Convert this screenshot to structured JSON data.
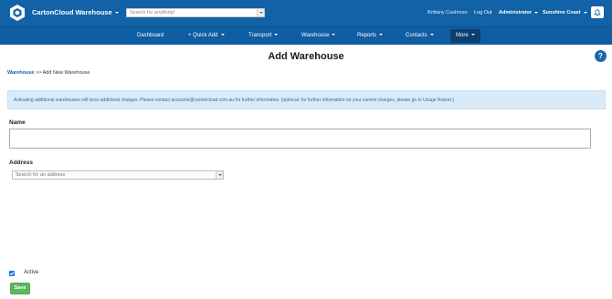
{
  "header": {
    "brand": "CartonCloud Warehouse",
    "search_placeholder": "Search for anything!",
    "user_name": "Brittany Cashman",
    "logout_label": "Log Out",
    "role": "Administrator",
    "region": "Sunshine Coast"
  },
  "nav": {
    "items": [
      {
        "label": "Dashboard"
      },
      {
        "label": "+ Quick Add"
      },
      {
        "label": "Transport"
      },
      {
        "label": "Warehouse"
      },
      {
        "label": "Reports"
      },
      {
        "label": "Contacts"
      },
      {
        "label": "More"
      }
    ],
    "active_index": 6
  },
  "page": {
    "title": "Add Warehouse",
    "help_label": "?",
    "breadcrumb_link": "Warehouse",
    "breadcrumb_sep": " >> ",
    "breadcrumb_current": "Add New Warehouse",
    "notice": "Activating additional warehouses will incur additional charges. Please contact accounts@cartoncloud.com.au for further information. [optional: for further information on your current charges, please go to Usage Report.]"
  },
  "form": {
    "name_label": "Name",
    "name_value": "",
    "address_label": "Address",
    "address_placeholder": "Search for an address",
    "active_label": "Active",
    "active_checked": true,
    "save_label": "Save"
  },
  "colors": {
    "topbar": "#1162a6",
    "navbar": "#0f5da3",
    "notice_bg": "#d9ebf8",
    "save_button": "#5cb85c"
  }
}
